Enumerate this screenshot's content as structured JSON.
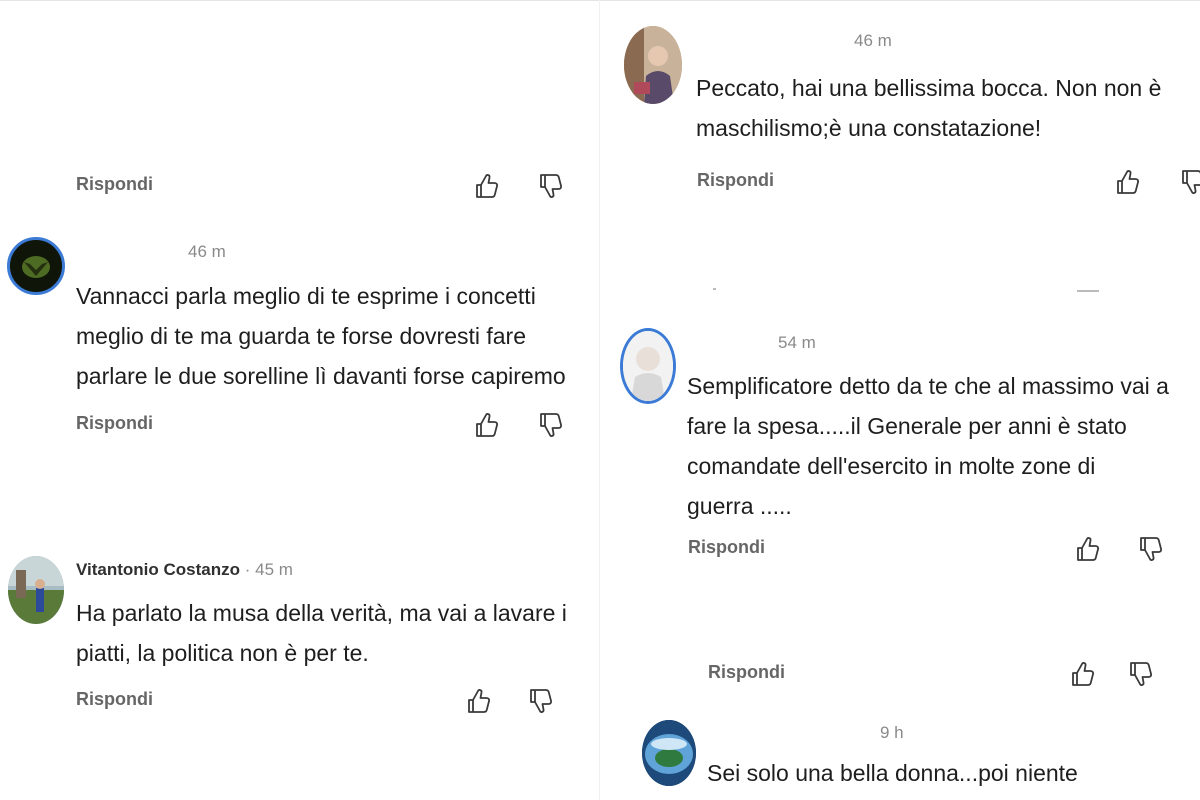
{
  "left": {
    "top_reply": "Rispondi",
    "comment1": {
      "time": "46 m",
      "lines": [
        "Vannacci  parla meglio di te esprime i concetti",
        "meglio di te ma guarda te forse dovresti fare",
        "parlare le due sorelline lì davanti forse capiremo"
      ],
      "reply": "Rispondi"
    },
    "comment2": {
      "author": "Vitantonio Costanzo",
      "separator": " · ",
      "time": "45 m",
      "lines": [
        "Ha parlato la musa della verità, ma vai a lavare i",
        "piatti, la politica non è per te."
      ],
      "reply": "Rispondi"
    }
  },
  "right": {
    "comment1": {
      "time": "46 m",
      "lines": [
        "Peccato, hai una bellissima bocca. Non non è",
        "maschilismo;è una constatazione!"
      ],
      "reply": "Rispondi"
    },
    "comment2": {
      "time": "54 m",
      "lines": [
        "Semplificatore detto da te che al massimo vai a",
        "fare la spesa.....il Generale per anni è stato",
        "comandate dell'esercito in molte zone di",
        "guerra ....."
      ],
      "reply": "Rispondi"
    },
    "middle_reply": "Rispondi",
    "comment3": {
      "time": "9 h",
      "lines": [
        "Sei solo una bella donna...poi niente"
      ]
    }
  },
  "icons": {
    "like": "thumbs-up-icon",
    "dislike": "thumbs-down-icon"
  },
  "colors": {
    "avatar_ring": "#3b7bd6",
    "reply_text": "#666666",
    "meta_text": "#8a8a8a"
  }
}
